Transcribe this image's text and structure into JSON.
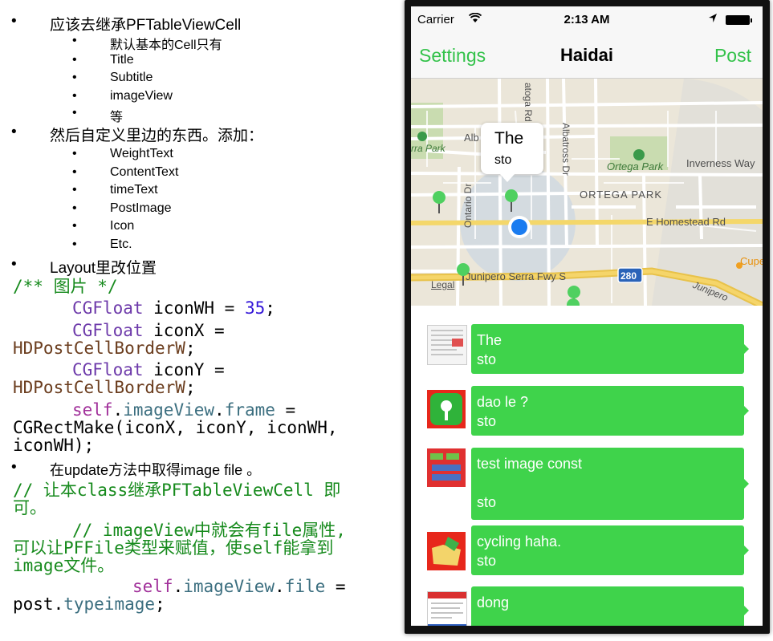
{
  "notes": {
    "bullet": "•",
    "item1": "应该去继承PFTableViewCell",
    "sub1": [
      "默认基本的Cell只有",
      "Title",
      "Subtitle",
      "imageView",
      "等"
    ],
    "item2": "然后自定义里边的东西。添加：",
    "sub2": [
      "WeightText",
      "ContentText",
      "timeText",
      "PostImage",
      "Icon",
      "Etc."
    ],
    "item3": "Layout里改位置",
    "code1": {
      "comment": "/** 图片 */",
      "kw_cgfloat": "CGFloat",
      "iconwh_decl": " iconWH = ",
      "iconwh_val": "35",
      "semicolon": ";",
      "iconx_decl": " iconX =",
      "border_macro": "HDPostCellBorderW",
      "icony_decl": " iconY =",
      "self": "self",
      "dot": ".",
      "imageview": "imageView",
      "frame": "frame",
      "eq": " =",
      "rect_line1": "CGRectMake(iconX, iconY, iconWH,",
      "rect_line2": "iconWH);"
    },
    "item4": "在update方法中取得image file 。",
    "code2": {
      "comment1_line1": "// 让本class继承PFTableViewCell 即",
      "comment1_line2": "可。",
      "comment2_line1": "// imageView中就会有file属性,",
      "comment2_line2": "可以让PFFile类型来赋值，使self能拿到",
      "comment2_line3": "image文件。",
      "self": "self",
      "dot": ".",
      "imageview": "imageView",
      "file": "file",
      "eq": " =",
      "post": "post",
      "typeimage": "typeimage",
      "semicolon": ";"
    }
  },
  "phone": {
    "status": {
      "carrier": "Carrier",
      "time": "2:13 AM"
    },
    "nav": {
      "left": "Settings",
      "title": "Haidai",
      "right": "Post"
    },
    "map": {
      "callout_title": "The",
      "callout_sub": "sto",
      "labels": {
        "ortega_park": "Ortega Park",
        "ortega_park_caps": "ORTEGA PARK",
        "inverness": "Inverness Way",
        "homestead": "E Homestead Rd",
        "junipero": "Junipero Serra Fwy S",
        "junipero2": "Junipero",
        "albatross": "Albatross Dr",
        "ontario": "Ontario Dr",
        "saratoga": "atoga Rd",
        "cupertino": "Cuperti",
        "highway": "280",
        "legal": "Legal",
        "park_left": "rra Park",
        "alb": "Alb"
      }
    },
    "posts": [
      {
        "line1": "The",
        "line2": "sto"
      },
      {
        "line1": "dao le ?",
        "line2": "sto"
      },
      {
        "line1": "test image const",
        "line2": "sto"
      },
      {
        "line1": "cycling haha.",
        "line2": "sto"
      },
      {
        "line1": "dong",
        "line2": ""
      }
    ],
    "colors": {
      "accent": "#33c24a",
      "bubble": "#3fd34b",
      "user_dot": "#1a7cf0"
    }
  }
}
